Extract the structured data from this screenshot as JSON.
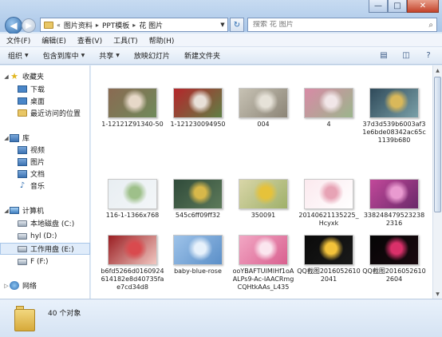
{
  "window": {
    "minimize_glyph": "—",
    "maximize_glyph": "□",
    "close_glyph": "✕"
  },
  "address": {
    "crumbs": [
      "图片资料",
      "PPT模板",
      "花 图片"
    ],
    "lead": "«"
  },
  "search": {
    "placeholder": "搜索 花 图片"
  },
  "menu": [
    "文件(F)",
    "编辑(E)",
    "查看(V)",
    "工具(T)",
    "帮助(H)"
  ],
  "toolbar": {
    "organize": "组织",
    "include_library": "包含到库中",
    "share": "共享",
    "slideshow": "放映幻灯片",
    "new_folder": "新建文件夹"
  },
  "sidebar": {
    "favorites": "收藏夹",
    "downloads": "下载",
    "desktop": "桌面",
    "recent": "最近访问的位置",
    "libraries": "库",
    "videos": "视频",
    "pictures": "图片",
    "documents": "文档",
    "music": "音乐",
    "computer": "计算机",
    "drive_c": "本地磁盘 (C:)",
    "drive_d": "hyl (D:)",
    "drive_e": "工作用盘 (E:)",
    "drive_f": "F (F:)",
    "network": "网络"
  },
  "files": [
    {
      "name": "1-12121Z91340-50",
      "colors": [
        "#8a6a52",
        "#e7d8c8",
        "#6f8a5a"
      ]
    },
    {
      "name": "1-121230094950",
      "colors": [
        "#b5262b",
        "#e8e0d8",
        "#5f7f45"
      ]
    },
    {
      "name": "004",
      "colors": [
        "#c7c2b4",
        "#e6e2d8",
        "#8c8577"
      ]
    },
    {
      "name": "4",
      "colors": [
        "#d88aa6",
        "#f1e6e8",
        "#9bb58c"
      ]
    },
    {
      "name": "37d3d539b6003af31e6bde08342ac65c1139b680",
      "colors": [
        "#2f4a5a",
        "#d9b85a",
        "#7aa0a8"
      ]
    },
    {
      "name": "116-1-1366x768",
      "colors": [
        "#e8eef2",
        "#9ec08a",
        "#f3f6f8"
      ]
    },
    {
      "name": "545c6ff09ff32",
      "colors": [
        "#2f4a3a",
        "#d8b84a",
        "#5d7a5a"
      ]
    },
    {
      "name": "350091",
      "colors": [
        "#d9d6a8",
        "#e6c23a",
        "#9fb06a"
      ]
    },
    {
      "name": "20140621135225_Hcyxk",
      "colors": [
        "#fbe9ee",
        "#e7a3b5",
        "#ffffff"
      ]
    },
    {
      "name": "3382484795232382316",
      "colors": [
        "#c2489a",
        "#e99ad0",
        "#6a2a6a"
      ]
    },
    {
      "name": "b6fd5266d0160924614182e8d40735fae7cd34d8",
      "colors": [
        "#9a1e22",
        "#d94a4e",
        "#f1c8c2"
      ]
    },
    {
      "name": "baby-blue-rose",
      "colors": [
        "#9ec3e9",
        "#e7f1fb",
        "#5b8fc8"
      ]
    },
    {
      "name": "ooYBAFTUIMIHf1oAALPs9-Ac-IAACRmgCQHtkAAs_L435",
      "colors": [
        "#f2a7c4",
        "#fbe6ef",
        "#d9608f"
      ]
    },
    {
      "name": "QQ截图20160526102041",
      "colors": [
        "#0a0a0a",
        "#f3c23a",
        "#1a1a1a"
      ]
    },
    {
      "name": "QQ截图20160526102604",
      "colors": [
        "#050505",
        "#d9306a",
        "#1a0a10"
      ]
    }
  ],
  "status": {
    "count": "40 个对象"
  }
}
